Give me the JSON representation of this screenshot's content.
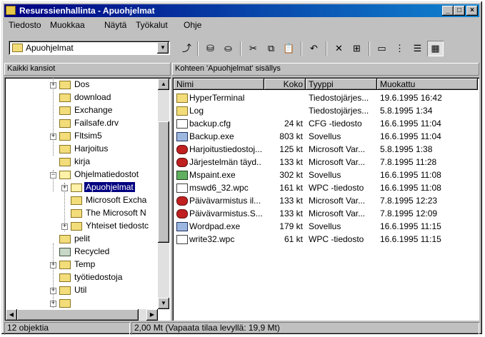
{
  "window": {
    "title": "Resurssienhallinta - Apuohjelmat",
    "min": "_",
    "max": "□",
    "close": "×"
  },
  "menu": [
    "Tiedosto",
    "Muokkaa",
    "Näytä",
    "Työkalut",
    "Ohje"
  ],
  "toolbar": {
    "location": "Apuohjelmat"
  },
  "left_header": "Kaikki kansiot",
  "right_header": "Kohteen 'Apuohjelmat' sisällys",
  "tree": [
    {
      "label": "Dos",
      "expander": "+"
    },
    {
      "label": "download"
    },
    {
      "label": "Exchange"
    },
    {
      "label": "Failsafe.drv"
    },
    {
      "label": "Fltsim5",
      "expander": "+"
    },
    {
      "label": "Harjoitus"
    },
    {
      "label": "kirja"
    },
    {
      "label": "Ohjelmatiedostot",
      "expander": "−"
    },
    {
      "label": "Apuohjelmat",
      "expander": "+"
    },
    {
      "label": "Microsoft Excha"
    },
    {
      "label": "The Microsoft N"
    },
    {
      "label": "Yhteiset tiedostc",
      "expander": "+"
    },
    {
      "label": "pelit"
    },
    {
      "label": "Recycled"
    },
    {
      "label": "Temp",
      "expander": "+"
    },
    {
      "label": "työtiedostoja"
    },
    {
      "label": "Util",
      "expander": "+"
    }
  ],
  "columns": [
    "Nimi",
    "Koko",
    "Tyyppi",
    "Muokattu"
  ],
  "files": [
    {
      "name": "HyperTerminal",
      "size": "",
      "type": "Tiedostojärjes...",
      "modified": "19.6.1995 16:42",
      "icon": "folder"
    },
    {
      "name": "Log",
      "size": "",
      "type": "Tiedostojärjes...",
      "modified": "5.8.1995 1:34",
      "icon": "folder"
    },
    {
      "name": "backup.cfg",
      "size": "24 kt",
      "type": "CFG -tiedosto",
      "modified": "16.6.1995 11:04",
      "icon": "doc"
    },
    {
      "name": "Backup.exe",
      "size": "803 kt",
      "type": "Sovellus",
      "modified": "16.6.1995 11:04",
      "icon": "exe"
    },
    {
      "name": "Harjoitustiedostoj...",
      "size": "125 kt",
      "type": "Microsoft Var...",
      "modified": "5.8.1995 1:38",
      "icon": "msv"
    },
    {
      "name": "Järjestelmän täyd...",
      "size": "133 kt",
      "type": "Microsoft Var...",
      "modified": "7.8.1995 11:28",
      "icon": "msv"
    },
    {
      "name": "Mspaint.exe",
      "size": "302 kt",
      "type": "Sovellus",
      "modified": "16.6.1995 11:08",
      "icon": "paint"
    },
    {
      "name": "mswd6_32.wpc",
      "size": "161 kt",
      "type": "WPC -tiedosto",
      "modified": "16.6.1995 11:08",
      "icon": "doc"
    },
    {
      "name": "Päivävarmistus il...",
      "size": "133 kt",
      "type": "Microsoft Var...",
      "modified": "7.8.1995 12:23",
      "icon": "msv"
    },
    {
      "name": "Päivävarmistus.S...",
      "size": "133 kt",
      "type": "Microsoft Var...",
      "modified": "7.8.1995 12:09",
      "icon": "msv"
    },
    {
      "name": "Wordpad.exe",
      "size": "179 kt",
      "type": "Sovellus",
      "modified": "16.6.1995 11:15",
      "icon": "exe"
    },
    {
      "name": "write32.wpc",
      "size": "61 kt",
      "type": "WPC -tiedosto",
      "modified": "16.6.1995 11:15",
      "icon": "doc"
    }
  ],
  "status": {
    "count": "12 objektia",
    "space": "2,00 Mt (Vapaata tilaa levyllä: 19,9 Mt)"
  }
}
